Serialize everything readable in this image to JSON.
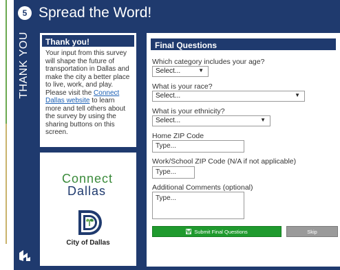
{
  "header": {
    "step_number": "5",
    "title": "Spread the Word!"
  },
  "sidebar": {
    "vertical_label": "THANK YOU"
  },
  "thanks_card": {
    "heading": "Thank you!",
    "body_before_link": "Your input from this survey will shape the future of transportation in Dallas and make the city a better place to live, work, and play. Please visit the ",
    "link_text": "Connect Dallas website",
    "body_after_link": " to learn more and tell others about the survey by using the sharing buttons on this screen."
  },
  "logo_card": {
    "connect_text": "Connect",
    "dallas_text": "Dallas",
    "city_name": "City of Dallas"
  },
  "final_questions": {
    "heading": "Final Questions",
    "age": {
      "label": "Which category includes your age?",
      "value": "Select..."
    },
    "race": {
      "label": "What is your race?",
      "value": "Select..."
    },
    "ethnicity": {
      "label": "What is your ethnicity?",
      "value": "Select..."
    },
    "home_zip": {
      "label": "Home ZIP Code",
      "placeholder": "Type..."
    },
    "work_zip": {
      "label": "Work/School ZIP Code (N/A if not applicable)",
      "placeholder": "Type..."
    },
    "comments": {
      "label": "Additional Comments (optional)",
      "placeholder": "Type..."
    },
    "submit_label": "Submit Final Questions",
    "skip_label": "Skip"
  },
  "colors": {
    "navy": "#1f3a6e",
    "submit_green": "#1f9a2e",
    "skip_gray": "#9a9a9a",
    "link_blue": "#1a5fb4"
  }
}
